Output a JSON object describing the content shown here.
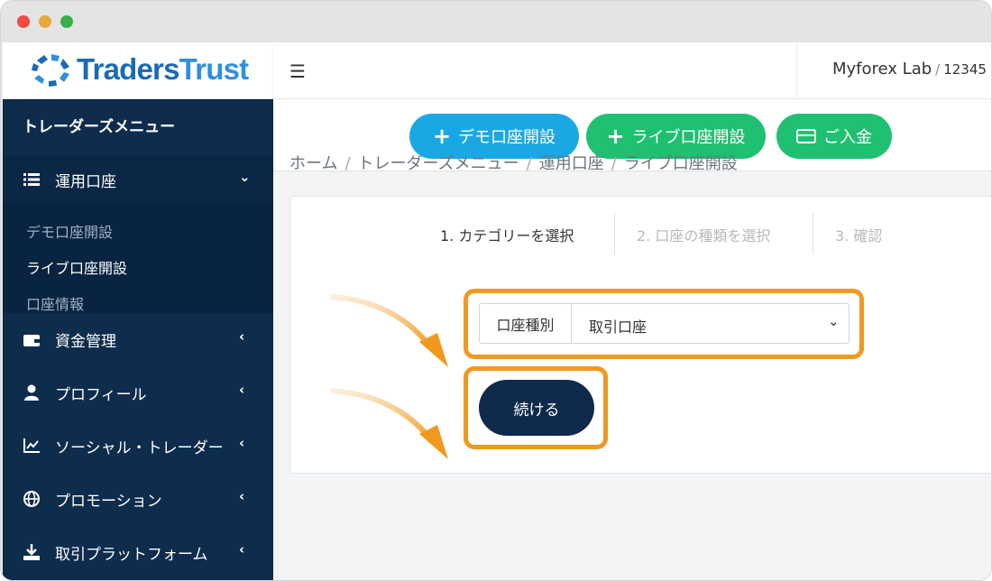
{
  "window": {
    "controls": [
      "close",
      "minimize",
      "maximize"
    ]
  },
  "brand": {
    "name_part1": "Traders",
    "name_part2": "Trust",
    "color_primary": "#1a6ab5",
    "color_secondary": "#2f8fe0"
  },
  "sidebar": {
    "title": "トレーダーズメニュー",
    "group": {
      "label": "運用口座",
      "icon": "list-icon",
      "sub_items": [
        {
          "label": "デモ口座開設",
          "active": false
        },
        {
          "label": "ライブ口座開設",
          "active": true
        },
        {
          "label": "口座情報",
          "active": false
        }
      ]
    },
    "items": [
      {
        "label": "資金管理",
        "icon": "wallet-icon"
      },
      {
        "label": "プロフィール",
        "icon": "user-icon"
      },
      {
        "label": "ソーシャル・トレーダー",
        "icon": "chart-icon"
      },
      {
        "label": "プロモーション",
        "icon": "globe-icon"
      },
      {
        "label": "取引プラットフォーム",
        "icon": "download-icon"
      }
    ]
  },
  "header": {
    "user_name": "Myforex Lab",
    "separator": "/",
    "account_id": "12345"
  },
  "actions": {
    "demo": "デモ口座開設",
    "live": "ライブ口座開設",
    "deposit": "ご入金",
    "colors": {
      "demo": "#19a8e4",
      "live": "#1fc071",
      "deposit": "#1fc071"
    }
  },
  "breadcrumb": [
    "ホーム",
    "トレーダーズメニュー",
    "運用口座",
    "ライブ口座開設"
  ],
  "steps": [
    "1. カテゴリーを選択",
    "2. 口座の種類を選択",
    "3. 確認"
  ],
  "form": {
    "account_type_label": "口座種別",
    "account_type_value": "取引口座",
    "continue_label": "続ける"
  },
  "highlight_color": "#f0991e"
}
